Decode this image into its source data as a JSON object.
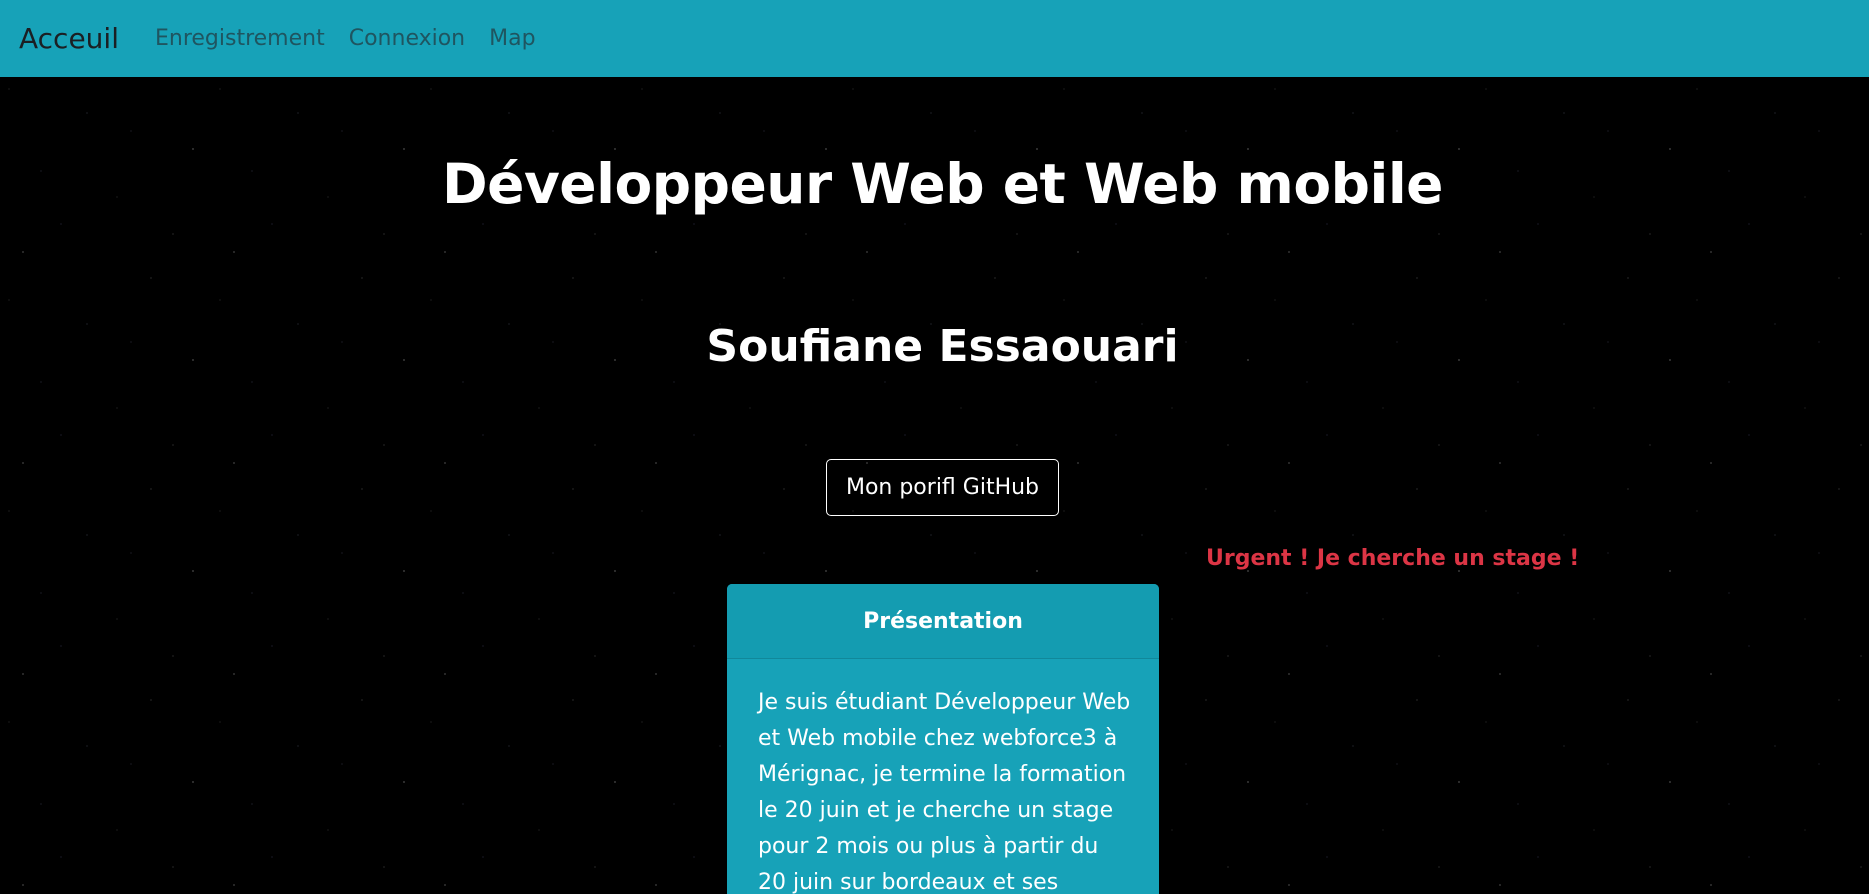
{
  "navbar": {
    "brand": "Acceuil",
    "links": [
      "Enregistrement",
      "Connexion",
      "Map"
    ],
    "background": "#17a2b8"
  },
  "hero": {
    "title": "Développeur Web et Web mobile",
    "name": "Soufiane Essaouari",
    "github_button": "Mon porifl GitHub"
  },
  "urgent_notice": {
    "text": "Urgent ! Je cherche un stage !",
    "color": "#dc3545"
  },
  "presentation_card": {
    "header": "Présentation",
    "body": "Je suis étudiant Développeur Web et Web mobile chez webforce3 à Mérignac, je termine la formation le 20 juin et je cherche un stage pour 2 mois ou plus à partir du 20 juin sur bordeaux et ses alentours."
  },
  "theme": {
    "background": "#000000",
    "text": "#ffffff"
  }
}
